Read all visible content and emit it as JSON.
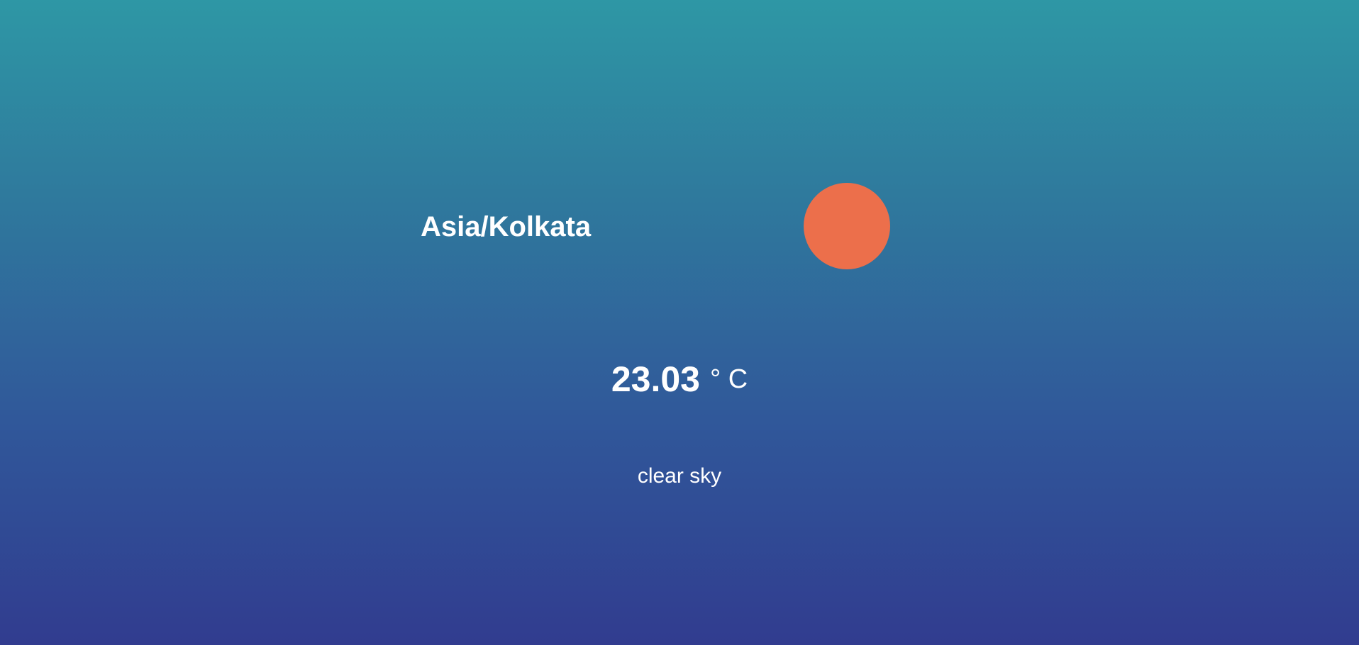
{
  "weather": {
    "timezone": "Asia/Kolkata",
    "temperature": "23.03",
    "unit": "° C",
    "description": "clear sky",
    "icon": "sun-icon"
  },
  "colors": {
    "sun": "#ec6f4b",
    "gradient_top": "#2e97a5",
    "gradient_bottom": "#313c8f",
    "text": "#ffffff"
  }
}
